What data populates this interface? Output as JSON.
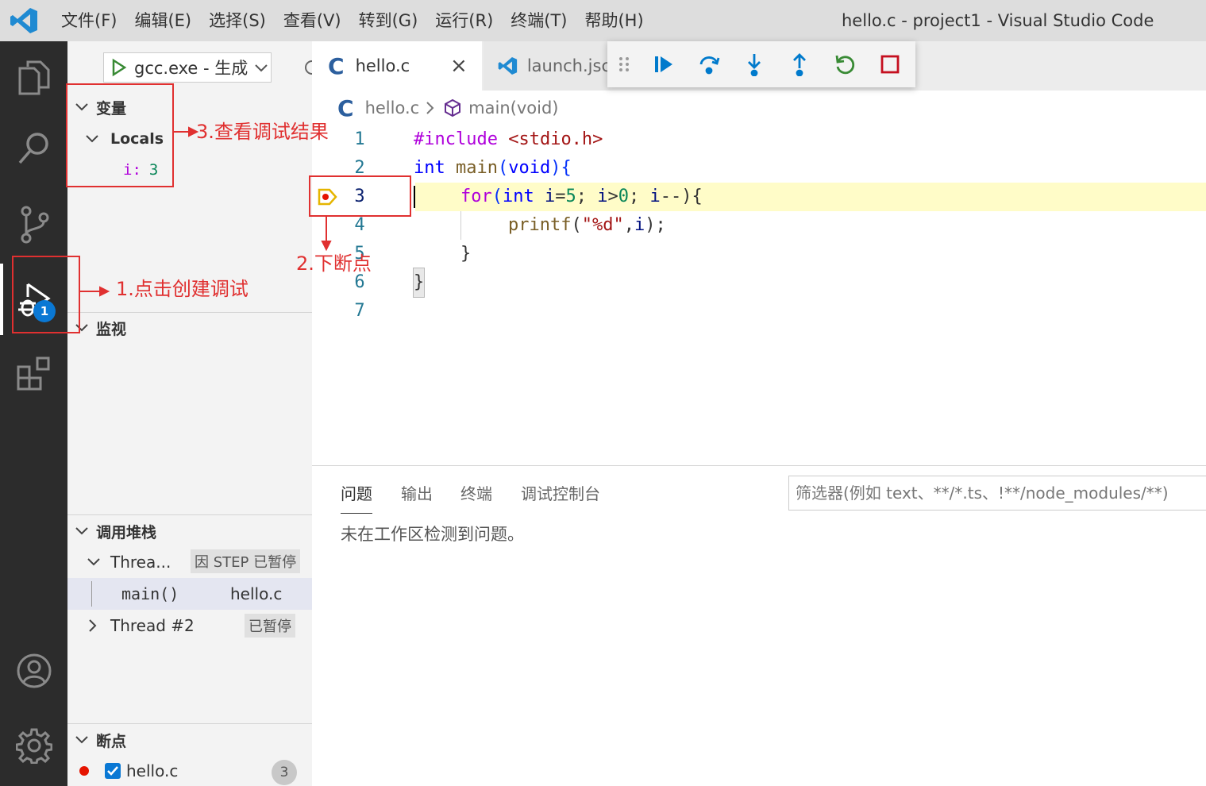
{
  "menu": [
    "文件(F)",
    "编辑(E)",
    "选择(S)",
    "查看(V)",
    "转到(G)",
    "运行(R)",
    "终端(T)",
    "帮助(H)"
  ],
  "window_title": "hello.c - project1 - Visual Studio Code",
  "activity": {
    "debug_badge": "1"
  },
  "sidebar": {
    "run_config": "gcc.exe - 生成",
    "variables": {
      "header": "变量",
      "locals_label": "Locals",
      "var_name": "i:",
      "var_value": "3"
    },
    "watch_header": "监视",
    "call_stack": {
      "header": "调用堆栈",
      "thread1": "Threa...",
      "thread1_status": "因 STEP 已暂停",
      "frame_fn": "main()",
      "frame_file": "hello.c",
      "thread2": "Thread #2",
      "thread2_status": "已暂停"
    },
    "breakpoints": {
      "header": "断点",
      "file": "hello.c",
      "line": "3"
    }
  },
  "tabs": [
    {
      "label": "hello.c",
      "close": "×"
    },
    {
      "label": "launch.jsc"
    }
  ],
  "breadcrumb": {
    "file": "hello.c",
    "symbol": "main(void)"
  },
  "code_lines": [
    "1",
    "2",
    "3",
    "4",
    "5",
    "6",
    "7"
  ],
  "code": {
    "l1_a": "#include",
    "l1_b": " <stdio.h>",
    "l2_a": "int",
    "l2_b": " main",
    "l2_c": "(",
    "l2_d": "void",
    "l2_e": "){",
    "l3_a": "for",
    "l3_b": "(",
    "l3_c": "int",
    "l3_d": " i",
    "l3_e": "=",
    "l3_f": "5",
    "l3_g": "; ",
    "l3_h": "i",
    "l3_i": ">",
    "l3_j": "0",
    "l3_k": "; ",
    "l3_l": "i",
    "l3_m": "--){",
    "l4_a": "printf",
    "l4_b": "(",
    "l4_c": "\"%d\"",
    "l4_d": ",",
    "l4_e": "i",
    "l4_f": ");",
    "l5": "}",
    "l6": "}"
  },
  "panel": {
    "tabs": [
      "问题",
      "输出",
      "终端",
      "调试控制台"
    ],
    "filter_placeholder": "筛选器(例如 text、**/*.ts、!**/node_modules/**)",
    "message": "未在工作区检测到问题。"
  },
  "annotations": {
    "step1": "1.点击创建调试",
    "step2": "2.下断点",
    "step3": "3.查看调试结果"
  },
  "colors": {
    "annotation": "#e03030",
    "activity_bg": "#2c2c2c",
    "badge": "#0a78d4",
    "current_line": "#fffcc8"
  }
}
